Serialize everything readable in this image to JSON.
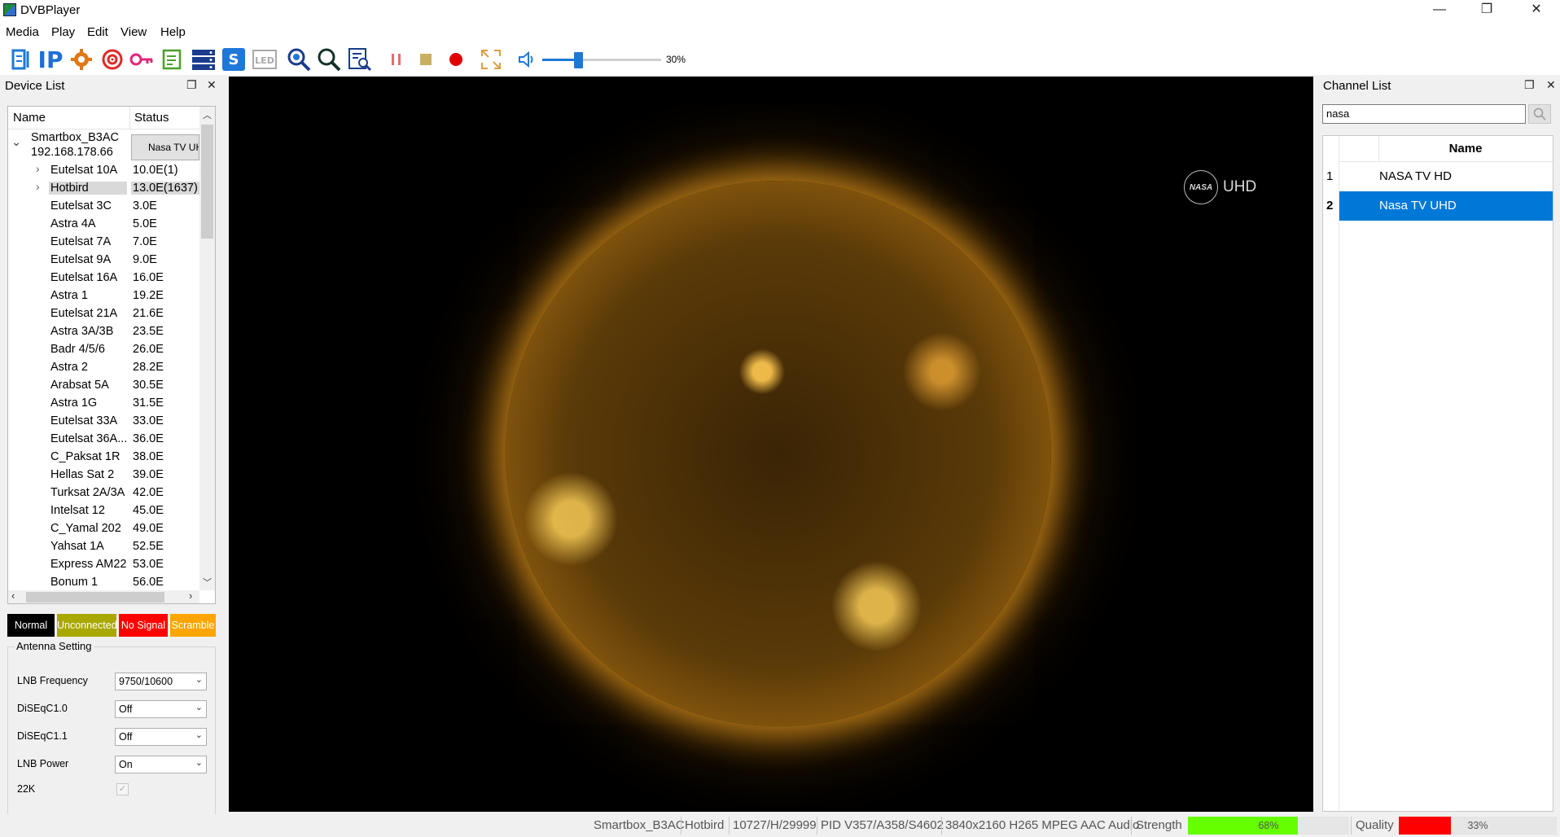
{
  "window": {
    "title": "DVBPlayer",
    "minimize": "—",
    "maximize": "❐",
    "close": "✕"
  },
  "menu": [
    "Media",
    "Play",
    "Edit",
    "View",
    "Help"
  ],
  "toolbar": {
    "volume_label": "30%",
    "volume_level": 0.3,
    "icons": [
      "scan-icon",
      "ip-icon",
      "settings-gear-icon",
      "target-icon",
      "key-icon",
      "edit-list-icon",
      "server-icon",
      "cam-icon",
      "led-icon",
      "zoom-scan-icon",
      "search-icon",
      "search-list-icon",
      "pause-icon",
      "stop-icon",
      "record-icon",
      "fullscreen-icon",
      "speaker-icon"
    ]
  },
  "device_panel": {
    "title": "Device List",
    "columns": {
      "name": "Name",
      "status": "Status"
    },
    "device": {
      "name": "Smartbox_B3AC",
      "ip": "192.168.178.66",
      "status": "Nasa TV UHD"
    },
    "satellites": [
      {
        "name": "Eutelsat 10A",
        "status": "10.0E(1)",
        "expandable": true
      },
      {
        "name": "Hotbird",
        "status": "13.0E(1637)",
        "expandable": true,
        "selected": true
      },
      {
        "name": "Eutelsat 3C",
        "status": "3.0E"
      },
      {
        "name": "Astra 4A",
        "status": "5.0E"
      },
      {
        "name": "Eutelsat 7A",
        "status": "7.0E"
      },
      {
        "name": "Eutelsat 9A",
        "status": "9.0E"
      },
      {
        "name": "Eutelsat 16A",
        "status": "16.0E"
      },
      {
        "name": "Astra 1",
        "status": "19.2E"
      },
      {
        "name": "Eutelsat 21A",
        "status": "21.6E"
      },
      {
        "name": "Astra 3A/3B",
        "status": "23.5E"
      },
      {
        "name": "Badr 4/5/6",
        "status": "26.0E"
      },
      {
        "name": "Astra 2",
        "status": "28.2E"
      },
      {
        "name": "Arabsat 5A",
        "status": "30.5E"
      },
      {
        "name": "Astra 1G",
        "status": "31.5E"
      },
      {
        "name": "Eutelsat 33A",
        "status": "33.0E"
      },
      {
        "name": "Eutelsat 36A...",
        "status": "36.0E"
      },
      {
        "name": "C_Paksat 1R",
        "status": "38.0E"
      },
      {
        "name": "Hellas Sat 2",
        "status": "39.0E"
      },
      {
        "name": "Turksat 2A/3A",
        "status": "42.0E"
      },
      {
        "name": "Intelsat 12",
        "status": "45.0E"
      },
      {
        "name": "C_Yamal 202",
        "status": "49.0E"
      },
      {
        "name": "Yahsat 1A",
        "status": "52.5E"
      },
      {
        "name": "Express AM22",
        "status": "53.0E"
      },
      {
        "name": "Bonum 1",
        "status": "56.0E"
      }
    ],
    "legend": [
      {
        "label": "Normal",
        "bg": "#000000",
        "fg": "#ffffff"
      },
      {
        "label": "Unconnected",
        "bg": "#a8a800",
        "fg": "#ffffff"
      },
      {
        "label": "No Signal",
        "bg": "#ff0000",
        "fg": "#ffffff"
      },
      {
        "label": "Scramble",
        "bg": "#ffa500",
        "fg": "#ffffff"
      }
    ],
    "antenna": {
      "title": "Antenna Setting",
      "lnb_frequency_label": "LNB Frequency",
      "lnb_frequency": "9750/10600",
      "diseqc10_label": "DiSEqC1.0",
      "diseqc10": "Off",
      "diseqc11_label": "DiSEqC1.1",
      "diseqc11": "Off",
      "lnb_power_label": "LNB Power",
      "lnb_power": "On",
      "k22_label": "22K",
      "k22_checked": true
    }
  },
  "video": {
    "logo_text": "NASA",
    "overlay_text": "UHD"
  },
  "channel_panel": {
    "title": "Channel List",
    "search_value": "nasa",
    "column_name": "Name",
    "channels": [
      {
        "index": "1",
        "name": "NASA TV HD"
      },
      {
        "index": "2",
        "name": "Nasa TV UHD",
        "selected": true
      }
    ]
  },
  "statusbar": {
    "device": "Smartbox_B3AC",
    "satellite": "Hotbird",
    "transponder": "10727/H/29999",
    "pids": "PID V357/A358/S4602",
    "format": "3840x2160 H265 MPEG AAC Audio",
    "strength_label": "Strength",
    "strength_value": "68%",
    "strength_level": 0.68,
    "strength_color": "#66ff00",
    "quality_label": "Quality",
    "quality_value": "33%",
    "quality_level": 0.33,
    "quality_color": "#ff0000"
  }
}
